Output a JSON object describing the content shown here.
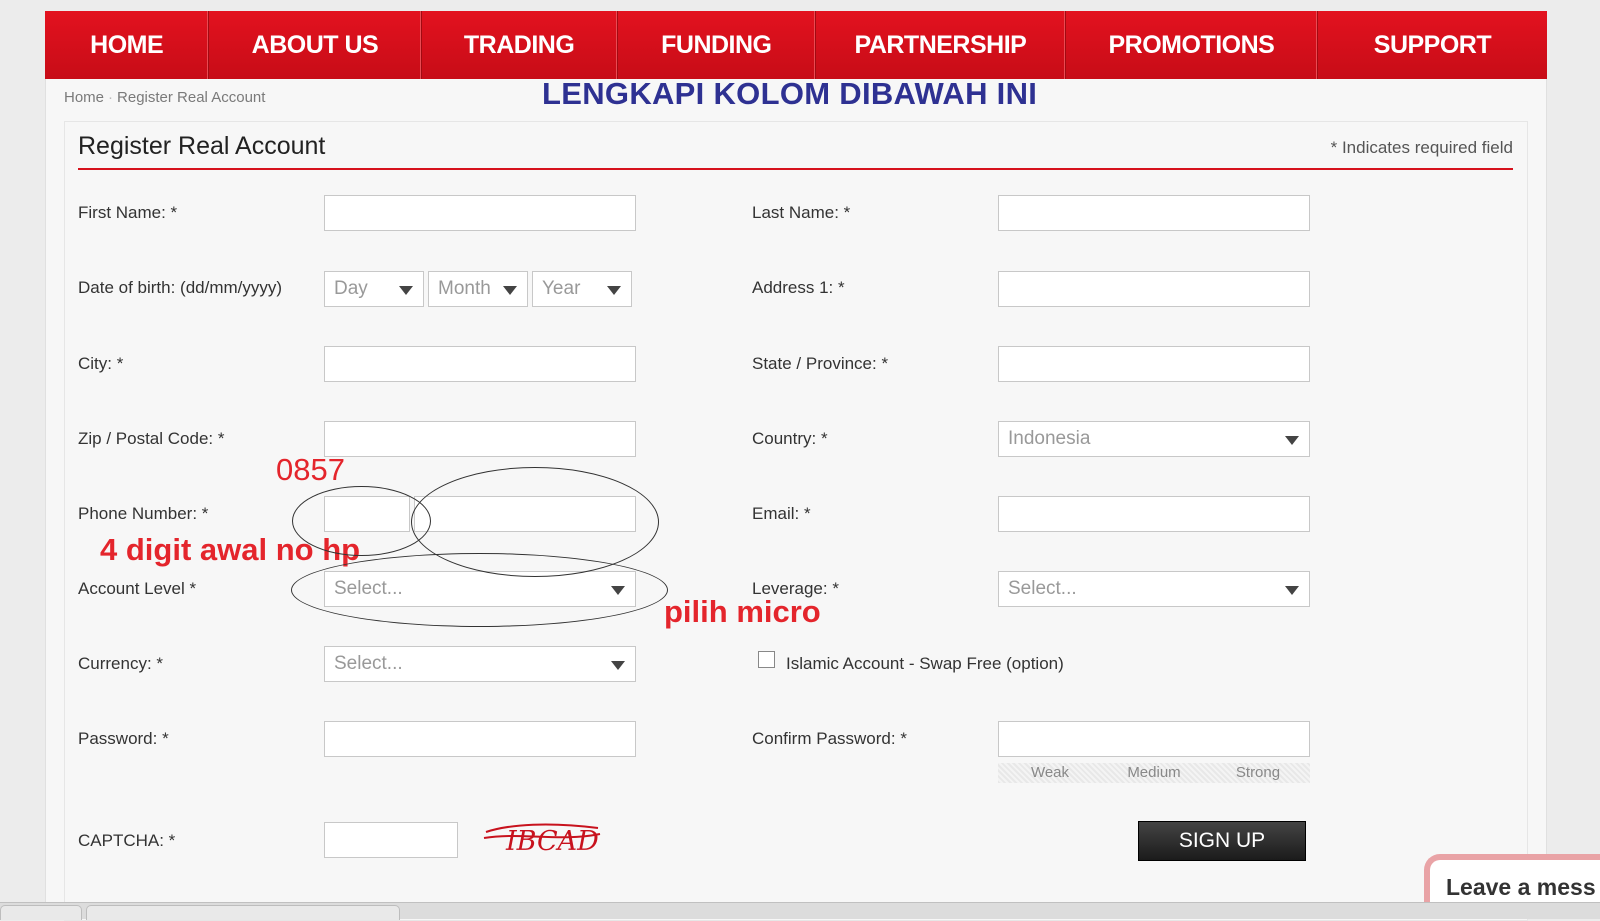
{
  "nav": {
    "items": [
      "HOME",
      "ABOUT US",
      "TRADING",
      "FUNDING",
      "PARTNERSHIP",
      "PROMOTIONS",
      "SUPPORT"
    ]
  },
  "breadcrumb": {
    "home": "Home",
    "current": "Register Real Account"
  },
  "form": {
    "title": "Register Real Account",
    "required_note": "* Indicates required field",
    "overlay_heading": "LENGKAPI KOLOM DIBAWAH INI",
    "labels": {
      "first_name": "First Name: *",
      "last_name": "Last Name: *",
      "dob": "Date of birth: (dd/mm/yyyy)",
      "address1": "Address 1: *",
      "city": "City: *",
      "state": "State / Province: *",
      "zip": "Zip / Postal Code: *",
      "country": "Country: *",
      "phone": "Phone Number: *",
      "email": "Email: *",
      "account_level": "Account Level *",
      "leverage": "Leverage: *",
      "currency": "Currency: *",
      "islamic": "Islamic Account - Swap Free (option)",
      "password": "Password: *",
      "confirm_password": "Confirm Password: *",
      "captcha": "CAPTCHA: *"
    },
    "selects": {
      "day": "Day",
      "month": "Month",
      "year": "Year",
      "country": "Indonesia",
      "account_level": "Select...",
      "leverage": "Select...",
      "currency": "Select..."
    },
    "strength": [
      "Weak",
      "Medium",
      "Strong"
    ],
    "captcha_text": "IBCAD",
    "signup_label": "SIGN UP"
  },
  "annotations": {
    "phone_prefix": "0857",
    "phone_hint": "4 digit awal no hp",
    "level_hint": "pilih micro",
    "annotation_color": "#e4252c",
    "heading_color": "#2e3192"
  },
  "chat": {
    "label": "Leave a mess"
  },
  "colors": {
    "nav_red": "#d6121d",
    "rule_red": "#d6121d"
  }
}
